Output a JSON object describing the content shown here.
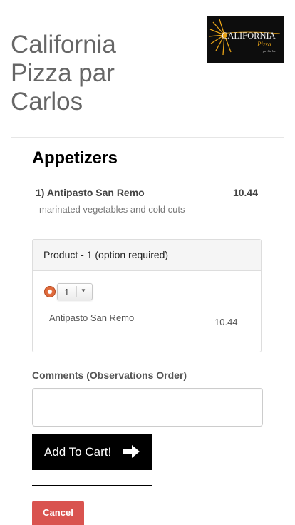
{
  "header": {
    "title": "California Pizza par Carlos",
    "logo": {
      "word": "CALIFORNIA",
      "sub": "Pizza",
      "tagline": "par Carlos",
      "icon": "sun-logo-icon"
    }
  },
  "menu": {
    "category": "Appetizers",
    "item": {
      "name": "1) Antipasto San Remo",
      "price": "10.44",
      "description": "marinated vegetables and cold cuts"
    }
  },
  "product_panel": {
    "heading": "Product - 1 (option required)",
    "quantity": "1",
    "option_name": "Antipasto San Remo",
    "option_price": "10.44"
  },
  "form": {
    "comments_label": "Comments (Observations Order)",
    "comments_value": "",
    "add_to_cart": "Add To Cart!",
    "cancel": "Cancel"
  },
  "colors": {
    "cancel": "#d9534f",
    "add_to_cart_bg": "#000000",
    "radio_selected": "#e06a3b",
    "logo_accent": "#e8a317"
  }
}
